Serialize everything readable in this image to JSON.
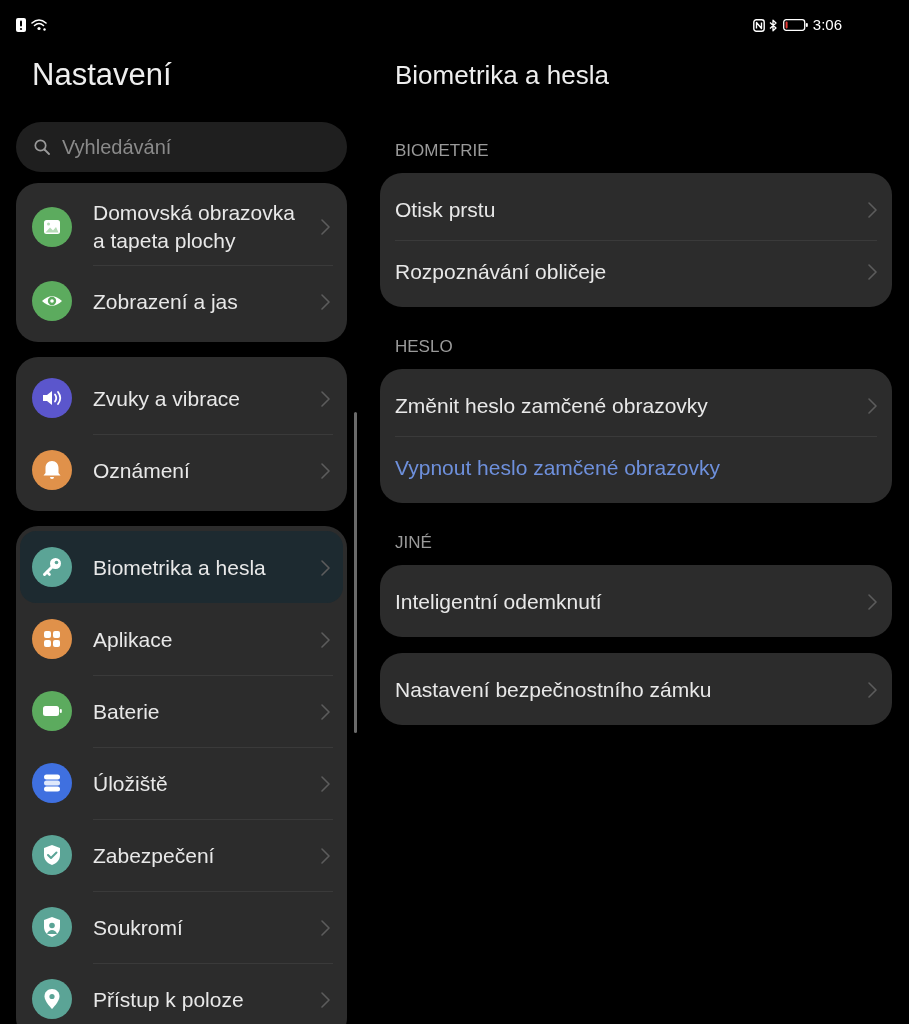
{
  "status_bar": {
    "time": "3:06"
  },
  "sidebar": {
    "title": "Nastavení",
    "search": {
      "placeholder": "Vyhledávání"
    },
    "groups": [
      {
        "items": [
          {
            "label": "Domovská obrazovka a tapeta plochy",
            "kind": "picture",
            "color": "#5cab5e",
            "selected": false
          },
          {
            "label": "Zobrazení a jas",
            "kind": "eye",
            "color": "#5cab5e",
            "selected": false
          }
        ]
      },
      {
        "items": [
          {
            "label": "Zvuky a vibrace",
            "kind": "speaker",
            "color": "#5b56cc",
            "selected": false
          },
          {
            "label": "Oznámení",
            "kind": "bell",
            "color": "#e0914a",
            "selected": false
          }
        ]
      },
      {
        "items": [
          {
            "label": "Biometrika a hesla",
            "kind": "key",
            "color": "#5ba496",
            "selected": true
          },
          {
            "label": "Aplikace",
            "kind": "grid",
            "color": "#e0914a",
            "selected": false
          },
          {
            "label": "Baterie",
            "kind": "battery",
            "color": "#5cab5e",
            "selected": false
          },
          {
            "label": "Úložiště",
            "kind": "stack",
            "color": "#3f70e0",
            "selected": false
          },
          {
            "label": "Zabezpečení",
            "kind": "shield-check",
            "color": "#5ba496",
            "selected": false
          },
          {
            "label": "Soukromí",
            "kind": "shield-person",
            "color": "#5ba496",
            "selected": false
          },
          {
            "label": "Přístup k poloze",
            "kind": "pin",
            "color": "#5ba496",
            "selected": false
          }
        ]
      }
    ]
  },
  "content": {
    "title": "Biometrika a hesla",
    "sections": [
      {
        "heading": "BIOMETRIE",
        "cards": [
          {
            "rows": [
              {
                "label": "Otisk prstu",
                "kind": "nav"
              },
              {
                "label": "Rozpoznávání obličeje",
                "kind": "nav"
              }
            ]
          }
        ]
      },
      {
        "heading": "HESLO",
        "cards": [
          {
            "rows": [
              {
                "label": "Změnit heslo zamčené obrazovky",
                "kind": "nav"
              },
              {
                "label": "Vypnout heslo zamčené obrazovky",
                "kind": "action"
              }
            ]
          }
        ]
      },
      {
        "heading": "JINÉ",
        "cards": [
          {
            "rows": [
              {
                "label": "Inteligentní odemknutí",
                "kind": "nav"
              }
            ]
          },
          {
            "rows": [
              {
                "label": "Nastavení bezpečnostního zámku",
                "kind": "nav"
              }
            ]
          }
        ]
      }
    ]
  }
}
